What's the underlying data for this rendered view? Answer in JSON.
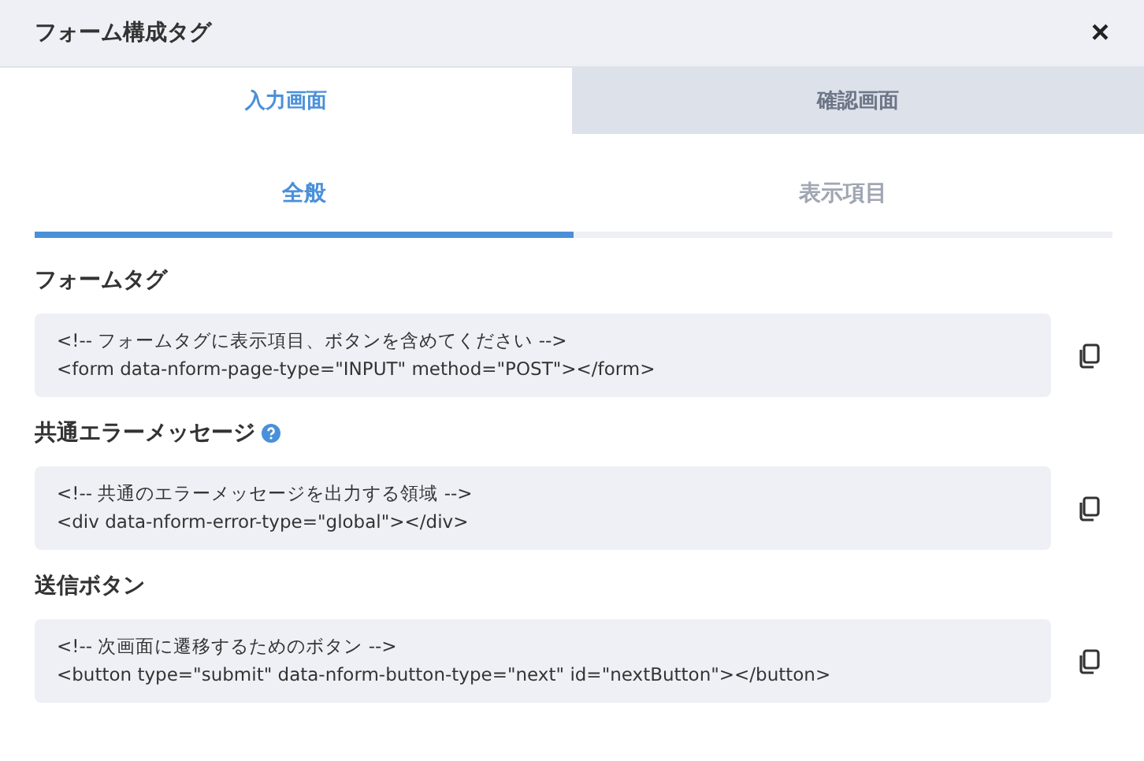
{
  "window": {
    "title": "フォーム構成タグ",
    "close": "×"
  },
  "tabs": [
    {
      "label": "入力画面",
      "selected": true
    },
    {
      "label": "確認画面",
      "selected": false
    }
  ],
  "subtabs": [
    {
      "label": "全般",
      "selected": true
    },
    {
      "label": "表示項目",
      "selected": false
    }
  ],
  "sections": [
    {
      "title": "フォームタグ",
      "help": false,
      "code": [
        "<!-- フォームタグに表示項目、ボタンを含めてください -->",
        "<form data-nform-page-type=\"INPUT\" method=\"POST\"></form>"
      ]
    },
    {
      "title": "共通エラーメッセージ",
      "help": true,
      "code": [
        "<!-- 共通のエラーメッセージを出力する領域 -->",
        "<div data-nform-error-type=\"global\"></div>"
      ]
    },
    {
      "title": "送信ボタン",
      "help": false,
      "code": [
        "<!-- 次画面に遷移するためのボタン -->",
        "<button type=\"submit\" data-nform-button-type=\"next\" id=\"nextButton\"></button>"
      ]
    }
  ]
}
